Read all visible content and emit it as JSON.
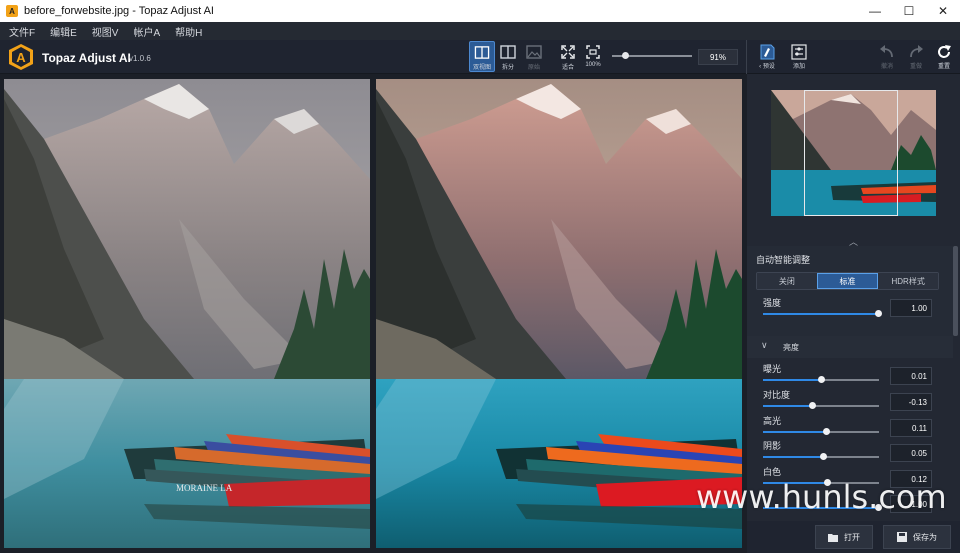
{
  "window": {
    "title": "before_forwebsite.jpg - Topaz Adjust AI",
    "title_icon": "topaz-logo-icon",
    "controls": [
      "minimize-icon",
      "maximize-icon",
      "close-icon"
    ],
    "minimize_glyph": "—",
    "maximize_glyph": "☐",
    "close_glyph": "✕"
  },
  "menu": {
    "items": [
      "文件F",
      "编辑E",
      "视图V",
      "帐户A",
      "帮助H"
    ]
  },
  "app": {
    "name": "Topaz Adjust AI",
    "version": "v1.0.6",
    "logo_letter": "A",
    "accent_color": "#2c5b96",
    "logo_color": "#f2a218"
  },
  "toolbar": {
    "dual_view_label": "双视图",
    "split_label": "拆分",
    "single_label": "原始",
    "fit_label": "适合",
    "zoom100_label": "100%",
    "zoom_value": "91%",
    "zoom_level": 0.16,
    "preset_label": "预设",
    "add_label": "添加",
    "undo_label": "撤消",
    "redo_label": "重做",
    "reset_label": "重置"
  },
  "sidebar": {
    "collapse_glyph": "︿",
    "auto_adjust": {
      "title": "自动智能调整",
      "modes": [
        "关闭",
        "标准",
        "HDR样式"
      ],
      "selected_mode": "标准",
      "strength_label": "强度",
      "strength_value": "1.00",
      "strength_level": 1.0
    },
    "brightness": {
      "title": "亮度",
      "chevron": "∨",
      "params": [
        {
          "label": "曝光",
          "value": "0.01",
          "level": 0.505
        },
        {
          "label": "对比度",
          "value": "-0.13",
          "level": 0.435
        },
        {
          "label": "高光",
          "value": "0.11",
          "level": 0.555
        },
        {
          "label": "阴影",
          "value": "0.05",
          "level": 0.525
        },
        {
          "label": "白色",
          "value": "0.12",
          "level": 0.56
        },
        {
          "label": "",
          "value": "1.00",
          "level": 1.0
        }
      ]
    }
  },
  "bottom": {
    "open_label": "打开",
    "save_as_label": "保存为"
  },
  "watermark": "www.hunls.com"
}
